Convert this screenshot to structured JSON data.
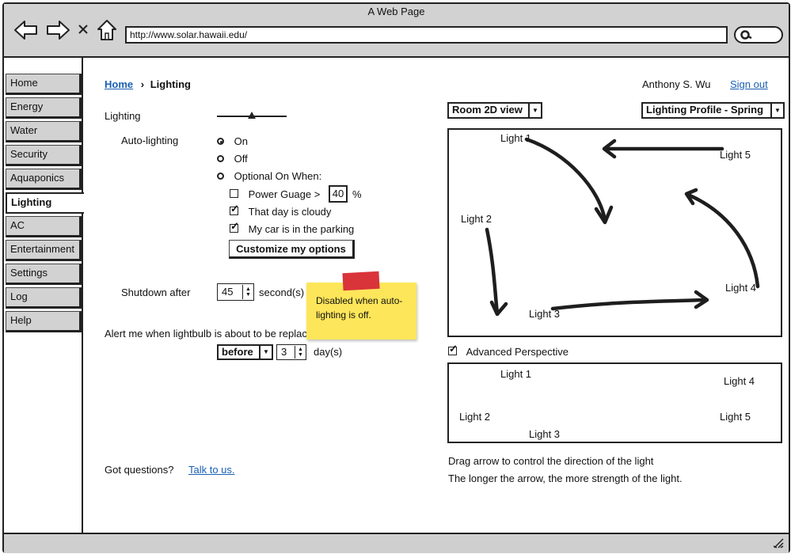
{
  "window": {
    "title": "A Web Page",
    "url": "http://www.solar.hawaii.edu/"
  },
  "nav": {
    "items": [
      {
        "label": "Home"
      },
      {
        "label": "Energy"
      },
      {
        "label": "Water"
      },
      {
        "label": "Security"
      },
      {
        "label": "Aquaponics"
      },
      {
        "label": "Lighting"
      },
      {
        "label": "AC"
      },
      {
        "label": "Entertainment"
      },
      {
        "label": "Settings"
      },
      {
        "label": "Log"
      },
      {
        "label": "Help"
      }
    ],
    "active": "Lighting"
  },
  "breadcrumb": {
    "home": "Home",
    "current": "Lighting"
  },
  "user": {
    "name": "Anthony S. Wu",
    "sign_out": "Sign out"
  },
  "lighting": {
    "label": "Lighting",
    "slider_level": 0.5,
    "auto_label": "Auto-lighting",
    "options": {
      "on": "On",
      "off": "Off",
      "optional": "Optional On When:"
    },
    "selected": "On",
    "power_gauge_label": "Power Guage >",
    "power_gauge_value": "40",
    "percent_sign": "%",
    "cloudy_label": "That day is cloudy",
    "parking_label": "My car is in the parking",
    "customize_button": "Customize my options",
    "shutdown_label": "Shutdown after",
    "shutdown_value": "45",
    "shutdown_unit": "second(s)",
    "alert_label": "Alert me when lightbulb is about to be replac",
    "alert_when": "before",
    "alert_days": "3",
    "alert_unit": "day(s)",
    "sticky_note": "Disabled when auto-lighting is off."
  },
  "footer": {
    "question": "Got questions?",
    "talk_link": "Talk to us."
  },
  "view": {
    "room_view": "Room 2D view",
    "profile": "Lighting Profile - Spring",
    "lights": [
      "Light 1",
      "Light 2",
      "Light 3",
      "Light 4",
      "Light 5"
    ],
    "advanced_label": "Advanced Perspective",
    "hint1": "Drag arrow to control the direction of the light",
    "hint2": "The longer the arrow, the more strength of the light."
  }
}
